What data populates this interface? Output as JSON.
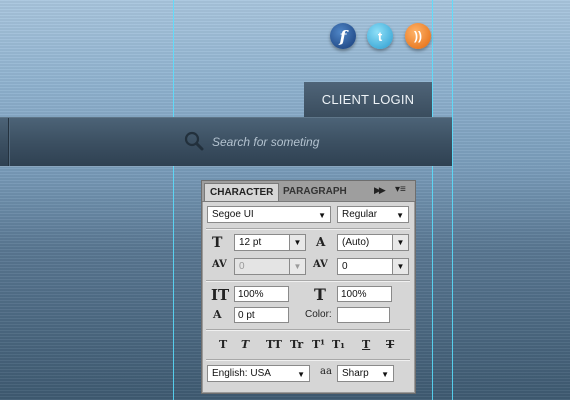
{
  "social": {
    "facebook_glyph": "f",
    "twitter_glyph": "t",
    "rss_glyph": "))"
  },
  "header": {
    "client_login_label": "CLIENT LOGIN"
  },
  "search": {
    "placeholder": "Search for someting"
  },
  "panel": {
    "tabs": {
      "character": "CHARACTER",
      "paragraph": "PARAGRAPH"
    },
    "font_family": "Segoe UI",
    "font_style": "Regular",
    "font_size": "12 pt",
    "leading": "(Auto)",
    "kerning": "0",
    "tracking": "0",
    "vertical_scale": "100%",
    "horizontal_scale": "100%",
    "baseline_shift": "0 pt",
    "color_label": "Color:",
    "format_buttons": [
      "T",
      "T",
      "TT",
      "Tr",
      "T¹",
      "T₁",
      "T",
      "T"
    ],
    "language": "English: USA",
    "antialias": "Sharp",
    "aa_glyph": "aa"
  }
}
